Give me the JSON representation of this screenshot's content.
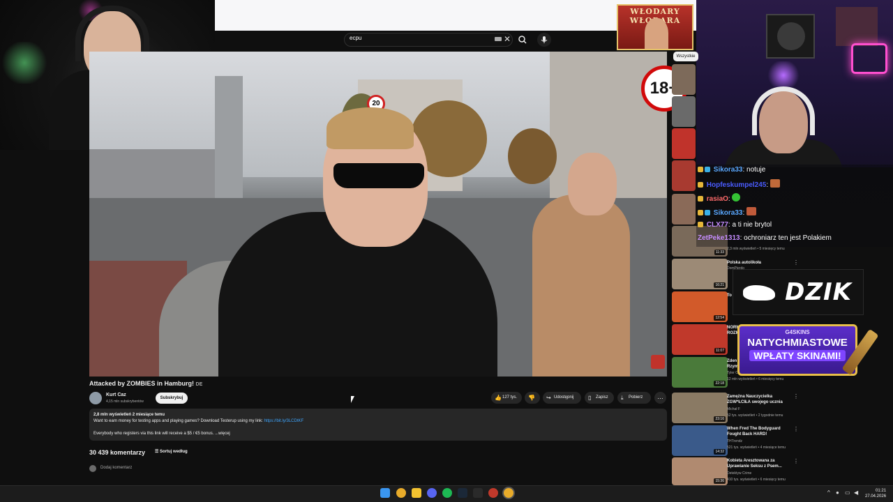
{
  "search": {
    "query": "ecpu"
  },
  "overlay": {
    "age_badge": "18+",
    "logo_text": "WŁODARY WŁODARA"
  },
  "video": {
    "title": "Attacked by ZOMBIES in Hamburg!",
    "lang_badge": "DE",
    "channel_name": "Kurt Caz",
    "channel_subs": "4,15 mln subskrybentów",
    "subscribe_label": "Subskrybuj",
    "likes_label": "127 tys.",
    "share_label": "Udostępnij",
    "save_label": "Zapisz",
    "download_label": "Pobierz",
    "desc_meta": "2,8 mln wyświetleń  2 miesiące temu",
    "desc_line1": "Want to earn money for testing apps and playing games? Download Testerup using my link: ",
    "desc_link": "https://bit.ly/3LCDtKF",
    "desc_line2": "Everybody who registers via this link will receive a $5 / €5 bonus. ...więcej",
    "comments_count": "30 439 komentarzy",
    "sort_label": "Sortuj według",
    "add_comment_placeholder": "Dodaj komentarz"
  },
  "sidebar": {
    "chip": "Wszystkie",
    "items": [
      {
        "duration": "11:33",
        "views": "2,3 mln wyświetleń • 5 miesięcy temu"
      },
      {
        "duration": "16:21",
        "title": "Polska autolikoła",
        "channel": "DomPierdo"
      },
      {
        "duration": "12:54",
        "title": "To"
      },
      {
        "duration": "11:07",
        "title": "NORM ROZM"
      },
      {
        "duration": "22:18",
        "title": "Zden Rzym",
        "channel": "Tyler O",
        "views": "12 mln wyświetleń • 6 miesięcy temu"
      },
      {
        "duration": "23:16",
        "title": "Zamężna Nauczycielka ZGW*ŁCIŁA swojego ucznia",
        "channel": "Michał F",
        "views": "52 tys. wyświetleń • 2 tygodnie temu"
      },
      {
        "duration": "14:32",
        "title": "When Fred The Bodyguard Fought Back HARD!",
        "channel": "THTrendz",
        "views": "521 tys. wyświetleń • 4 miesiące temu"
      },
      {
        "duration": "15:36",
        "title": "Kobieta Aresztowana za Uprawianie Seksu z Psem...",
        "channel": "Detektyw Crime",
        "views": "410 tys. wyświetleń • 6 miesięcy temu"
      }
    ]
  },
  "chat": [
    {
      "user": "Sikora33",
      "color": "#5aa8ff",
      "text": ": notuje"
    },
    {
      "user": "Hopfeskumpel245",
      "color": "#4a5cff",
      "text": ":"
    },
    {
      "user": "rasiaO",
      "color": "#ff6b6b",
      "text": ":"
    },
    {
      "user": "Sikora33",
      "color": "#5aa8ff",
      "text": ":"
    },
    {
      "user": "CLX77",
      "color": "#c58cff",
      "text": ": a ti nie brytol"
    },
    {
      "user": "ZetPeke1313",
      "color": "#c58cff",
      "text": ": ochroniarz ten jest Polakiem"
    }
  ],
  "ads": {
    "dzik": "DZIK",
    "g4_brand": "G4SKINS",
    "g4_line1": "NATYCHMIASTOWE",
    "g4_line2": "WPŁATY SKINAMI!"
  },
  "taskbar": {
    "time": "01:21",
    "date": "27.04.2026"
  },
  "colors": {
    "accent_link": "#3ea6ff",
    "badge_red": "#d10a0a",
    "g4_purple": "#5b2ec9"
  }
}
